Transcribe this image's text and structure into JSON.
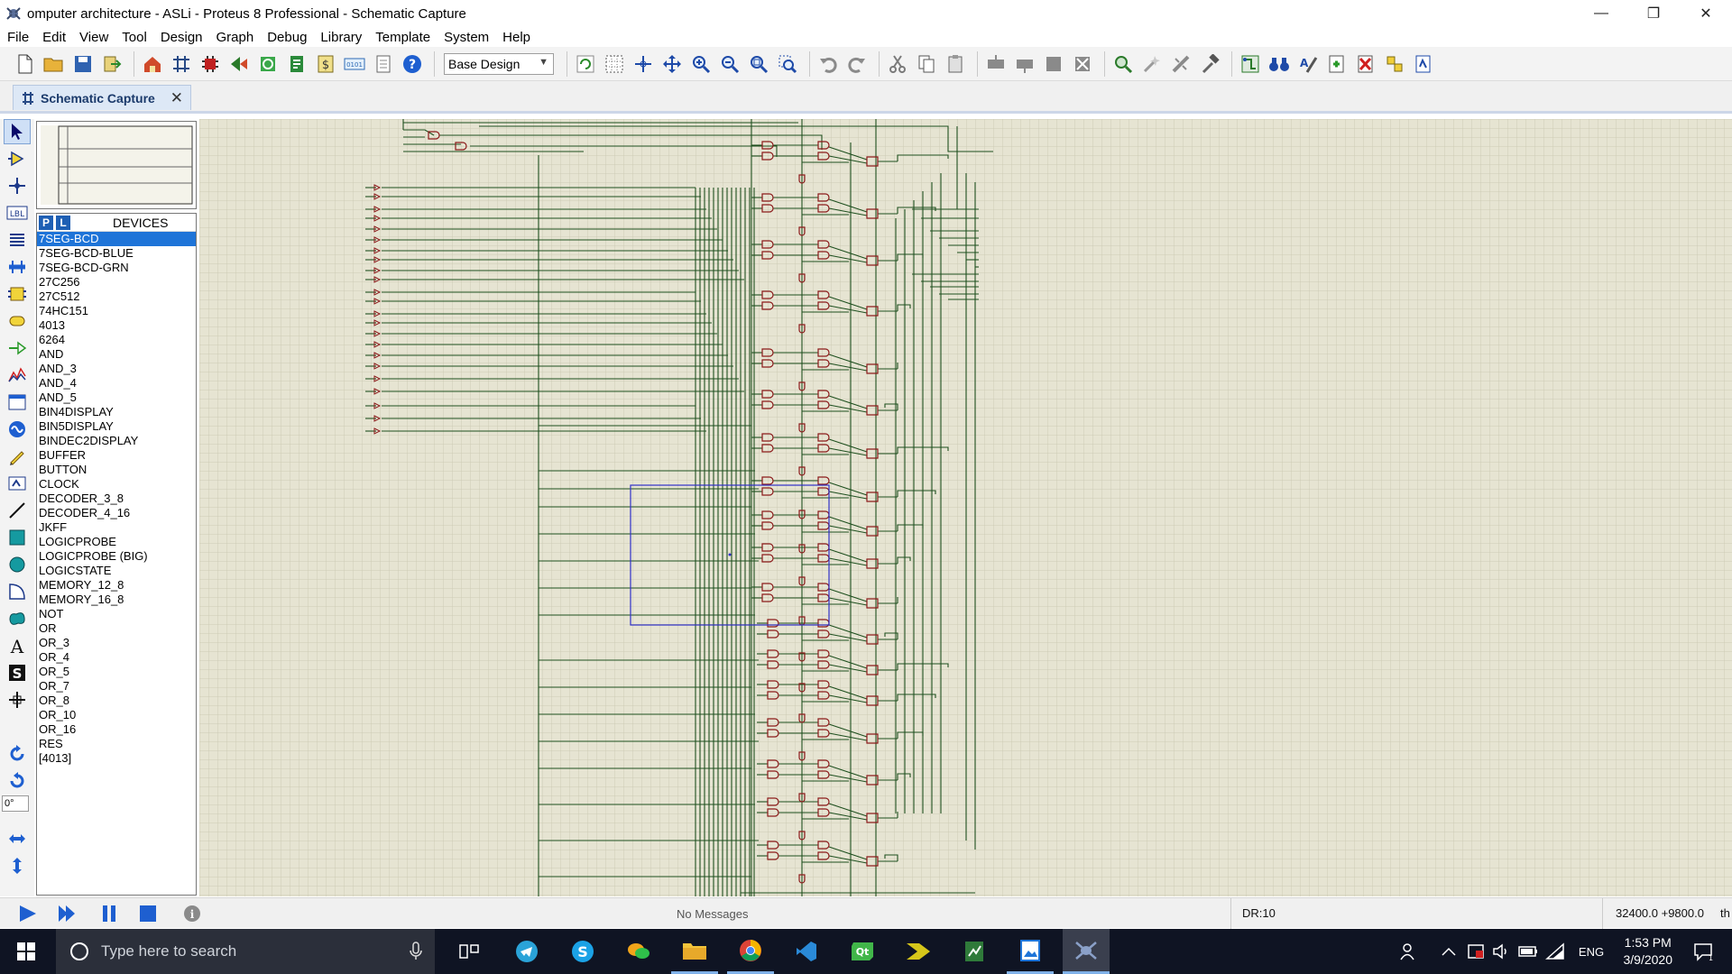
{
  "window": {
    "title": "omputer architecture - ASLi - Proteus 8 Professional - Schematic Capture",
    "minimize": "—",
    "restore": "❐",
    "close": "✕"
  },
  "menu": [
    "File",
    "Edit",
    "View",
    "Tool",
    "Design",
    "Graph",
    "Debug",
    "Library",
    "Template",
    "System",
    "Help"
  ],
  "toolbar": {
    "design_select": "Base Design"
  },
  "tab": {
    "label": "Schematic Capture"
  },
  "devices": {
    "p_button": "P",
    "l_button": "L",
    "header": "DEVICES",
    "items": [
      "7SEG-BCD",
      "7SEG-BCD-BLUE",
      "7SEG-BCD-GRN",
      "27C256",
      "27C512",
      "74HC151",
      "4013",
      "6264",
      "AND",
      "AND_3",
      "AND_4",
      "AND_5",
      "BIN4DISPLAY",
      "BIN5DISPLAY",
      "BINDEC2DISPLAY",
      "BUFFER",
      "BUTTON",
      "CLOCK",
      "DECODER_3_8",
      "DECODER_4_16",
      "JKFF",
      "LOGICPROBE",
      "LOGICPROBE (BIG)",
      "LOGICSTATE",
      "MEMORY_12_8",
      "MEMORY_16_8",
      "NOT",
      "OR",
      "OR_3",
      "OR_4",
      "OR_5",
      "OR_7",
      "OR_8",
      "OR_10",
      "OR_16",
      "RES",
      "[4013]"
    ],
    "selected_index": 0
  },
  "rotation": "0°",
  "status": {
    "message": "No Messages",
    "dr": "DR:10",
    "coords": "32400.0 +9800.0",
    "coords_unit": "th"
  },
  "taskbar": {
    "search_placeholder": "Type here to search",
    "language": "ENG",
    "time": "1:53 PM",
    "date": "3/9/2020"
  },
  "colors": {
    "canvas_bg": "#e6e4d2",
    "grid": "#cfcdb8",
    "wire": "#1e4f1e",
    "gate": "#8b1a1a",
    "selection": "#3030c8",
    "taskbar": "#0f1423",
    "accent": "#1e74d8"
  }
}
